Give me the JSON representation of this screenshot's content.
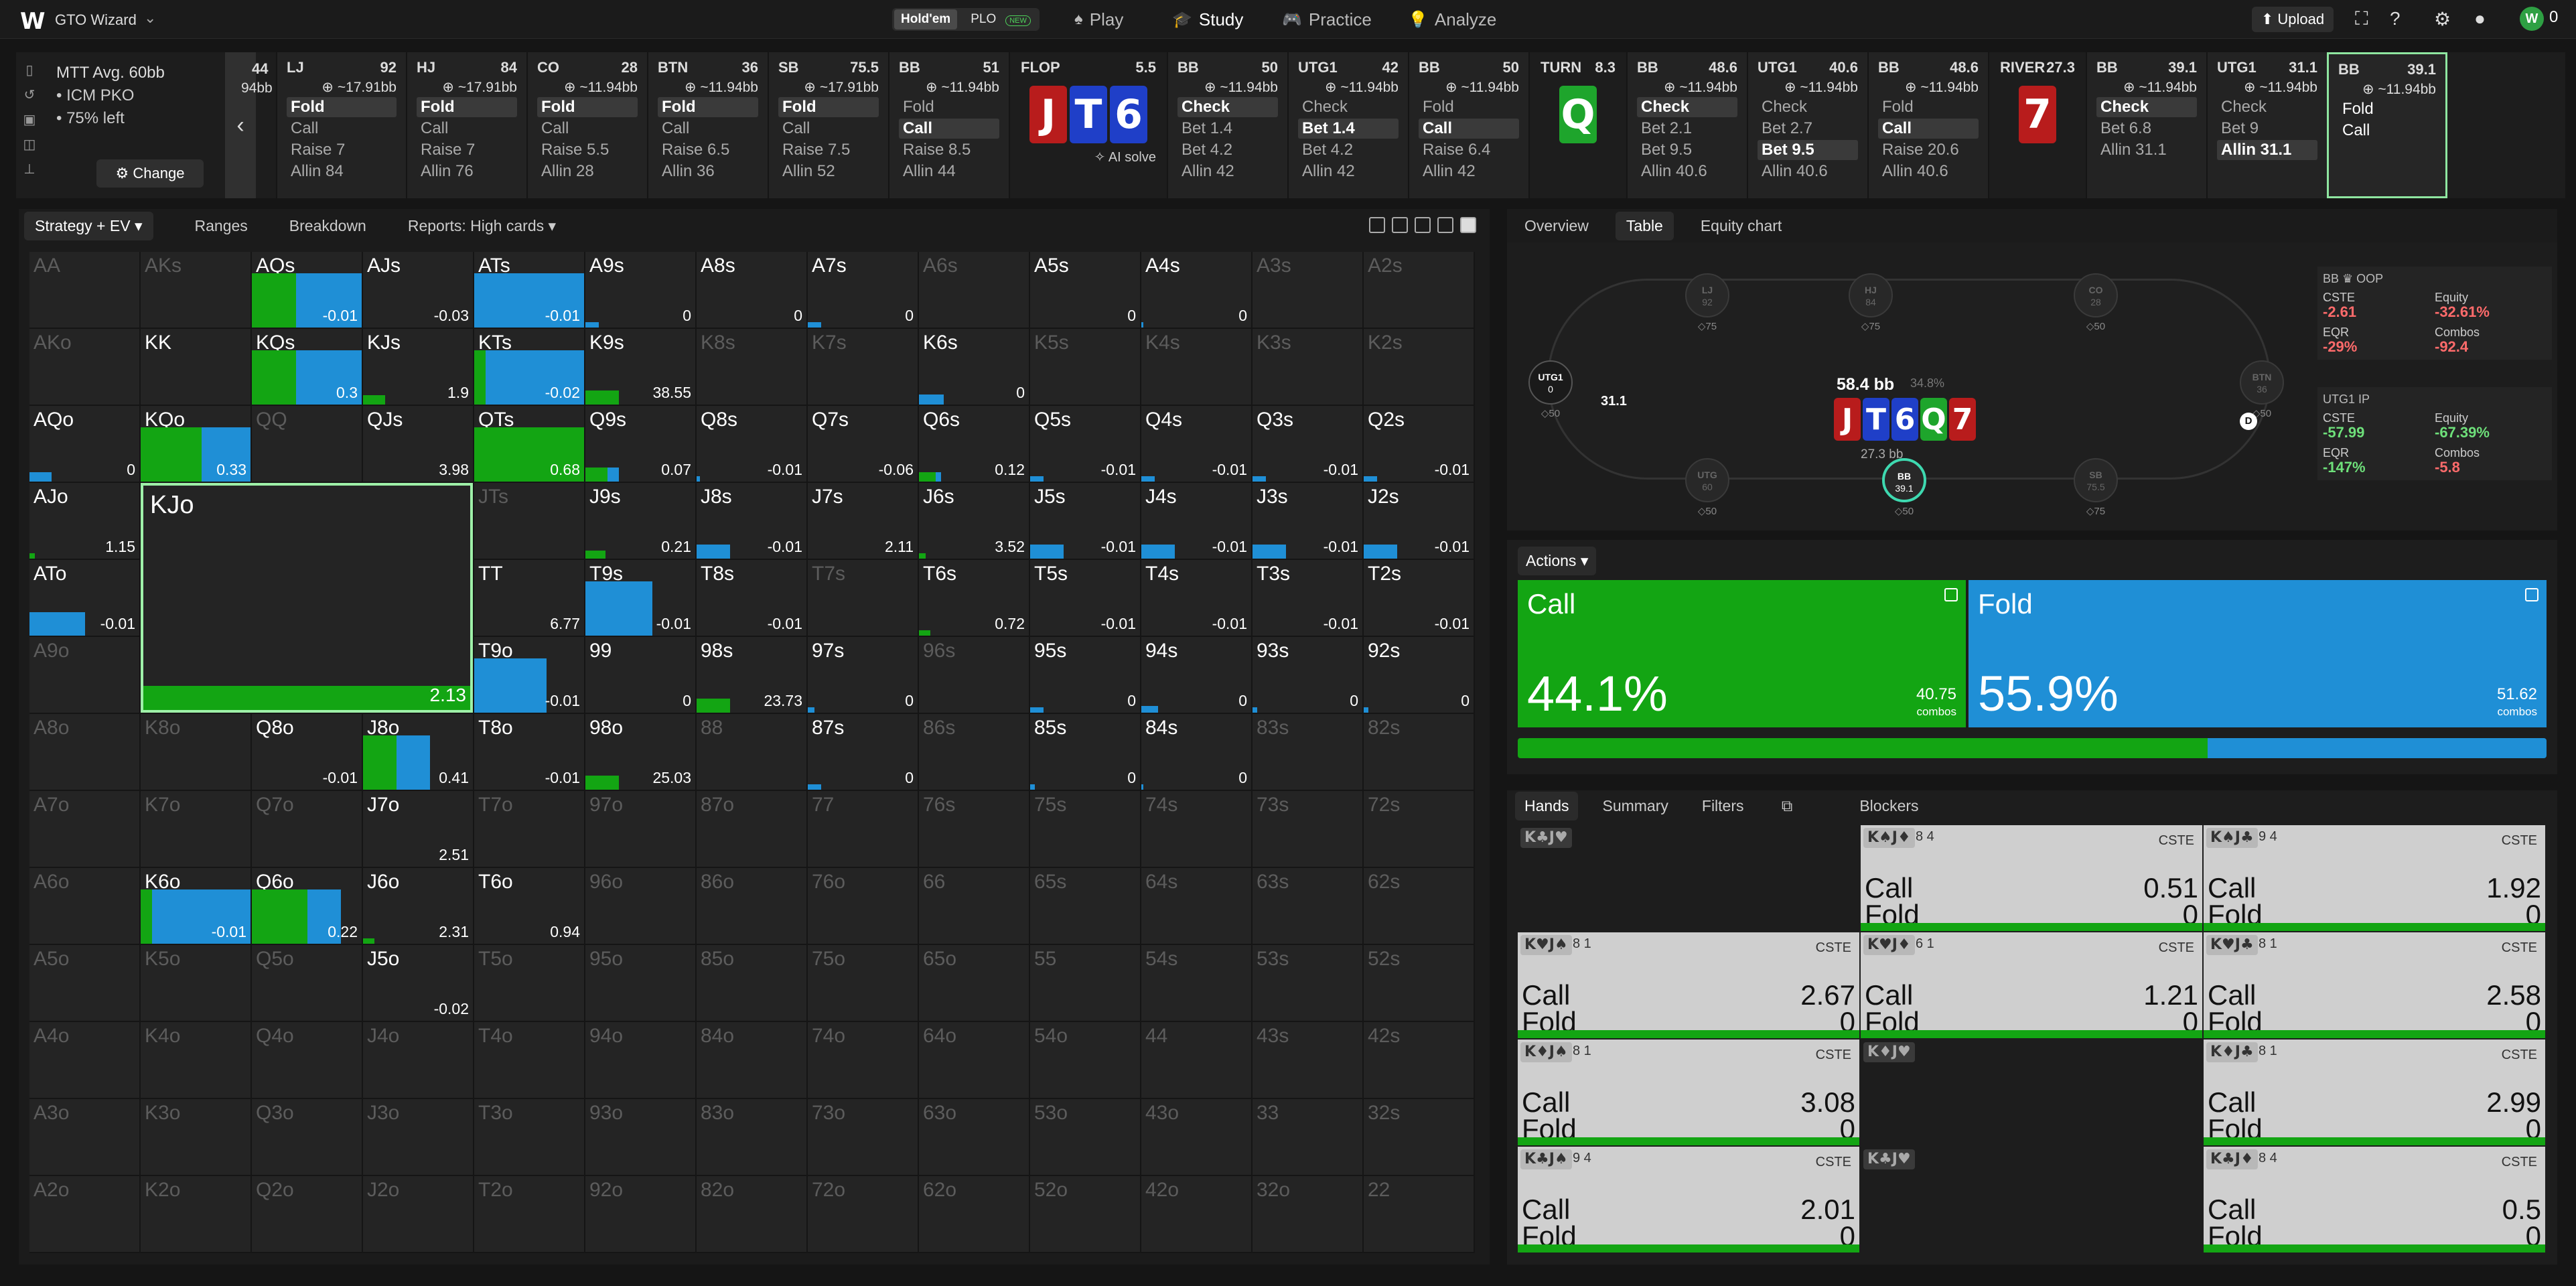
{
  "nav": {
    "logo": "W",
    "brand": "GTO Wizard",
    "game_toggle": [
      "Hold'em",
      "PLO"
    ],
    "new_badge": "NEW",
    "items": [
      {
        "label": "Play",
        "icon": "play-icon"
      },
      {
        "label": "Study",
        "icon": "study-icon"
      },
      {
        "label": "Practice",
        "icon": "practice-icon"
      },
      {
        "label": "Analyze",
        "icon": "analyze-icon"
      }
    ],
    "upload": "Upload",
    "coins": "0"
  },
  "tournament": {
    "line1": "MTT  Avg. 60bb",
    "line2": "•  ICM PKO",
    "line3": "•  75% left",
    "change": "Change"
  },
  "prev_card": {
    "top": "44",
    "sub": "94bb"
  },
  "cards": [
    {
      "pos": "LJ",
      "num": "92",
      "stack": "~17.91bb",
      "opts": [
        "Fold",
        "Call",
        "Raise 7",
        "Allin 84"
      ],
      "sel": 0
    },
    {
      "pos": "HJ",
      "num": "84",
      "stack": "~17.91bb",
      "opts": [
        "Fold",
        "Call",
        "Raise 7",
        "Allin 76"
      ],
      "sel": 0
    },
    {
      "pos": "CO",
      "num": "28",
      "stack": "~11.94bb",
      "opts": [
        "Fold",
        "Call",
        "Raise 5.5",
        "Allin 28"
      ],
      "sel": 0
    },
    {
      "pos": "BTN",
      "num": "36",
      "stack": "~11.94bb",
      "opts": [
        "Fold",
        "Call",
        "Raise 6.5",
        "Allin 36"
      ],
      "sel": 0
    },
    {
      "pos": "SB",
      "num": "75.5",
      "stack": "~17.91bb",
      "opts": [
        "Fold",
        "Call",
        "Raise 7.5",
        "Allin 52"
      ],
      "sel": 0
    },
    {
      "pos": "BB",
      "num": "51",
      "stack": "~11.94bb",
      "opts": [
        "Fold",
        "Call",
        "Raise 8.5",
        "Allin 44"
      ],
      "sel": 1
    },
    {
      "street": "FLOP",
      "num": "5.5",
      "board": [
        [
          "J",
          "#b81c1c"
        ],
        [
          "T",
          "#1f3fc8"
        ],
        [
          "6",
          "#1f3fc8"
        ]
      ],
      "ai": "AI solve"
    },
    {
      "pos": "BB",
      "num": "50",
      "stack": "~11.94bb",
      "opts": [
        "Check",
        "Bet 1.4",
        "Bet 4.2",
        "Allin 42"
      ],
      "sel": 0
    },
    {
      "pos": "UTG1",
      "num": "42",
      "stack": "~11.94bb",
      "opts": [
        "Check",
        "Bet 1.4",
        "Bet 4.2",
        "Allin 42"
      ],
      "sel": 1
    },
    {
      "pos": "BB",
      "num": "50",
      "stack": "~11.94bb",
      "opts": [
        "Fold",
        "Call",
        "Raise 6.4",
        "Allin 42"
      ],
      "sel": 1
    },
    {
      "street": "TURN",
      "num": "8.3",
      "board": [
        [
          "Q",
          "#1ea52c"
        ]
      ]
    },
    {
      "pos": "BB",
      "num": "48.6",
      "stack": "~11.94bb",
      "opts": [
        "Check",
        "Bet 2.1",
        "Bet 9.5",
        "Allin 40.6"
      ],
      "sel": 0
    },
    {
      "pos": "UTG1",
      "num": "40.6",
      "stack": "~11.94bb",
      "opts": [
        "Check",
        "Bet 2.7",
        "Bet 9.5",
        "Allin 40.6"
      ],
      "sel": 2
    },
    {
      "pos": "BB",
      "num": "48.6",
      "stack": "~11.94bb",
      "opts": [
        "Fold",
        "Call",
        "Raise 20.6",
        "Allin 40.6"
      ],
      "sel": 1
    },
    {
      "street": "RIVER",
      "num": "27.3",
      "board": [
        [
          "7",
          "#b81c1c"
        ]
      ]
    },
    {
      "pos": "BB",
      "num": "39.1",
      "stack": "~11.94bb",
      "opts": [
        "Check",
        "Bet 6.8",
        "Allin 31.1"
      ],
      "sel": 0
    },
    {
      "pos": "UTG1",
      "num": "31.1",
      "stack": "~11.94bb",
      "opts": [
        "Check",
        "Bet 9",
        "Allin 31.1"
      ],
      "sel": 2
    },
    {
      "pos": "BB",
      "num": "39.1",
      "stack": "~11.94bb",
      "opts": [
        "Fold",
        "Call"
      ],
      "sel": -1,
      "active": true
    }
  ],
  "matrix_tabs": [
    "Strategy + EV",
    "Ranges",
    "Breakdown",
    "Reports: High cards"
  ],
  "matrix": {
    "ranks": [
      "A",
      "K",
      "Q",
      "J",
      "T",
      "9",
      "8",
      "7",
      "6",
      "5",
      "4",
      "3",
      "2"
    ],
    "zoom": {
      "hand": "KJo",
      "ev": "2.13"
    },
    "cells": {
      "AQs": {
        "c": 0.4,
        "f": 0.6,
        "ev": "-0.01"
      },
      "AJs": {
        "c": 0,
        "f": 0,
        "ev": "-0.03"
      },
      "ATs": {
        "c": 0,
        "f": 1,
        "ev": "-0.01"
      },
      "A9s": {
        "c": 0,
        "f": 0.12,
        "ev": "0"
      },
      "A8s": {
        "c": 0,
        "f": 0,
        "ev": "0"
      },
      "A7s": {
        "c": 0,
        "f": 0.12,
        "ev": "0"
      },
      "A5s": {
        "c": 0,
        "f": 0,
        "ev": "0"
      },
      "A4s": {
        "c": 0,
        "f": 0.02,
        "ev": "0"
      },
      "KQs": {
        "c": 0.4,
        "f": 0.6,
        "ev": "0.3"
      },
      "KJs": {
        "c": 0.2,
        "f": 0,
        "ev": "1.9"
      },
      "KTs": {
        "c": 0.1,
        "f": 0.9,
        "ev": "-0.02"
      },
      "K9s": {
        "c": 0.3,
        "f": 0,
        "ev": "38.55"
      },
      "K6s": {
        "c": 0,
        "f": 0.22,
        "ev": "0"
      },
      "AQo": {
        "c": 0,
        "f": 0.2,
        "ev": "0"
      },
      "KQo": {
        "c": 0.55,
        "f": 0.45,
        "ev": "0.33"
      },
      "QJs": {
        "c": 0,
        "f": 0,
        "ev": "3.98"
      },
      "QTs": {
        "c": 1,
        "f": 0,
        "ev": "0.68"
      },
      "Q9s": {
        "c": 0.2,
        "f": 0.1,
        "ev": "0.07"
      },
      "Q8s": {
        "c": 0,
        "f": 0.03,
        "ev": "-0.01"
      },
      "Q7s": {
        "c": 0,
        "f": 0,
        "ev": "-0.06"
      },
      "Q6s": {
        "c": 0.15,
        "f": 0.05,
        "ev": "0.12"
      },
      "Q5s": {
        "c": 0,
        "f": 0.12,
        "ev": "-0.01"
      },
      "Q4s": {
        "c": 0,
        "f": 0.12,
        "ev": "-0.01"
      },
      "Q3s": {
        "c": 0,
        "f": 0.12,
        "ev": "-0.01"
      },
      "Q2s": {
        "c": 0,
        "f": 0.12,
        "ev": "-0.01"
      },
      "AJo": {
        "c": 0.05,
        "f": 0,
        "ev": "1.15"
      },
      "J9s": {
        "c": 0.18,
        "f": 0,
        "ev": "0.21"
      },
      "J8s": {
        "c": 0,
        "f": 0.3,
        "ev": "-0.01"
      },
      "J7s": {
        "c": 0,
        "f": 0,
        "ev": "2.11"
      },
      "J6s": {
        "c": 0.06,
        "f": 0,
        "ev": "3.52"
      },
      "J5s": {
        "c": 0,
        "f": 0.3,
        "ev": "-0.01"
      },
      "J4s": {
        "c": 0,
        "f": 0.3,
        "ev": "-0.01"
      },
      "J3s": {
        "c": 0,
        "f": 0.3,
        "ev": "-0.01"
      },
      "J2s": {
        "c": 0,
        "f": 0.3,
        "ev": "-0.01"
      },
      "ATo": {
        "c": 0,
        "f": 0.5,
        "ev": "-0.01"
      },
      "TT": {
        "c": 0,
        "f": 0,
        "ev": "6.77"
      },
      "T9s": {
        "c": 0,
        "f": 0.6,
        "ev": "-0.01"
      },
      "T8s": {
        "c": 0,
        "f": 0,
        "ev": "-0.01"
      },
      "T6s": {
        "c": 0.1,
        "f": 0,
        "ev": "0.72"
      },
      "T5s": {
        "c": 0,
        "f": 0,
        "ev": "-0.01"
      },
      "T4s": {
        "c": 0,
        "f": 0,
        "ev": "-0.01"
      },
      "T3s": {
        "c": 0,
        "f": 0,
        "ev": "-0.01"
      },
      "T2s": {
        "c": 0,
        "f": 0,
        "ev": "-0.01"
      },
      "T9o": {
        "c": 0,
        "f": 0.65,
        "ev": "-0.01"
      },
      "99": {
        "c": 0,
        "f": 0,
        "ev": "0"
      },
      "98s": {
        "c": 0.3,
        "f": 0,
        "ev": "23.73"
      },
      "97s": {
        "c": 0,
        "f": 0.06,
        "ev": "0"
      },
      "95s": {
        "c": 0,
        "f": 0.12,
        "ev": "0"
      },
      "94s": {
        "c": 0,
        "f": 0.15,
        "ev": "0"
      },
      "93s": {
        "c": 0,
        "f": 0.04,
        "ev": "0"
      },
      "92s": {
        "c": 0,
        "f": 0.04,
        "ev": "0"
      },
      "Q8o": {
        "c": 0,
        "f": 0,
        "ev": "-0.01"
      },
      "J8o": {
        "c": 0.3,
        "f": 0.3,
        "ev": "0.41"
      },
      "T8o": {
        "c": 0,
        "f": 0,
        "ev": "-0.01"
      },
      "98o": {
        "c": 0.3,
        "f": 0,
        "ev": "25.03"
      },
      "87s": {
        "c": 0,
        "f": 0.12,
        "ev": "0"
      },
      "85s": {
        "c": 0,
        "f": 0.04,
        "ev": "0"
      },
      "84s": {
        "c": 0,
        "f": 0.02,
        "ev": "0"
      },
      "J7o": {
        "c": 0,
        "f": 0,
        "ev": "2.51"
      },
      "K6o": {
        "c": 0.1,
        "f": 0.9,
        "ev": "-0.01"
      },
      "Q6o": {
        "c": 0.5,
        "f": 0.3,
        "ev": "0.22"
      },
      "J6o": {
        "c": 0.1,
        "f": 0,
        "ev": "2.31"
      },
      "T6o": {
        "c": 0,
        "f": 0,
        "ev": "0.94"
      },
      "J5o": {
        "c": 0,
        "f": 0,
        "ev": "-0.02"
      }
    },
    "bright": [
      "AQs",
      "AJs",
      "ATs",
      "A9s",
      "A8s",
      "A7s",
      "A5s",
      "A4s",
      "KQs",
      "KJs",
      "KTs",
      "K9s",
      "K6s",
      "AQo",
      "KQo",
      "QJs",
      "QTs",
      "Q9s",
      "Q8s",
      "Q7s",
      "Q6s",
      "Q5s",
      "Q4s",
      "Q3s",
      "Q2s",
      "AJo",
      "J9s",
      "J8s",
      "J7s",
      "J6s",
      "J5s",
      "J4s",
      "J3s",
      "J2s",
      "ATo",
      "TT",
      "T9s",
      "T8s",
      "T6s",
      "T5s",
      "T4s",
      "T3s",
      "T2s",
      "T9o",
      "99",
      "98s",
      "97s",
      "95s",
      "94s",
      "93s",
      "92s",
      "Q8o",
      "J8o",
      "T8o",
      "98o",
      "87s",
      "85s",
      "84s",
      "J7o",
      "K6o",
      "Q6o",
      "J6o",
      "T6o",
      "J5o",
      "KK"
    ]
  },
  "right_tabs": [
    "Overview",
    "Table",
    "Equity chart"
  ],
  "table": {
    "seats": [
      {
        "name": "LJ",
        "val": "92",
        "st": "◇75"
      },
      {
        "name": "HJ",
        "val": "84",
        "st": "◇75"
      },
      {
        "name": "CO",
        "val": "28",
        "st": "◇50"
      },
      {
        "name": "BTN",
        "val": "36",
        "st": "◇50"
      },
      {
        "name": "SB",
        "val": "75.5",
        "st": "◇75"
      },
      {
        "name": "BB",
        "val": "39.1",
        "st": "◇50"
      },
      {
        "name": "UTG",
        "val": "60",
        "st": "◇50"
      },
      {
        "name": "UTG1",
        "val": "0",
        "st": "◇50"
      }
    ],
    "pot": "58.4 bb",
    "pot_pct": "34.8%",
    "board": [
      [
        "J",
        "#b81c1c"
      ],
      [
        "T",
        "#1f3fc8"
      ],
      [
        "6",
        "#1f3fc8"
      ],
      [
        "Q",
        "#1ea52c"
      ],
      [
        "7",
        "#b81c1c"
      ]
    ],
    "pot_base": "27.3 bb",
    "bet": "31.1",
    "dealer": "D"
  },
  "stats": [
    {
      "title": "BB ♛ OOP",
      "cste": "-2.61",
      "equity": "-32.61%",
      "eqr": "-29%",
      "combos": "-92.4"
    },
    {
      "title": "UTG1  IP",
      "cste": "-57.99",
      "equity": "-67.39%",
      "eqr": "-147%",
      "combos": "-5.8"
    }
  ],
  "stat_labels": {
    "cste": "CSTE",
    "equity": "Equity",
    "eqr": "EQR",
    "combos": "Combos"
  },
  "actions": {
    "button": "Actions",
    "call": {
      "name": "Call",
      "pct": "44.1%",
      "combos": "40.75",
      "combos_label": "combos",
      "freq": 0.441
    },
    "fold": {
      "name": "Fold",
      "pct": "55.9%",
      "combos": "51.62",
      "combos_label": "combos",
      "freq": 0.559
    }
  },
  "hand_tabs": [
    "Hands",
    "Summary",
    "Filters",
    "Blockers"
  ],
  "hands": [
    {
      "combo": "K♣J♥",
      "empty": true
    },
    {
      "combo": "K♠J♦",
      "blk": "8 4",
      "cste": "CSTE",
      "call": "0.51",
      "fold": "0"
    },
    {
      "combo": "K♠J♣",
      "blk": "9 4",
      "cste": "CSTE",
      "call": "1.92",
      "fold": "0"
    },
    {
      "combo": "K♥J♠",
      "blk": "8 1",
      "cste": "CSTE",
      "call": "2.67",
      "fold": "0"
    },
    {
      "combo": "K♥J♦",
      "blk": "6 1",
      "cste": "CSTE",
      "call": "1.21",
      "fold": "0"
    },
    {
      "combo": "K♥J♣",
      "blk": "8 1",
      "cste": "CSTE",
      "call": "2.58",
      "fold": "0"
    },
    {
      "combo": "K♦J♠",
      "blk": "8 1",
      "cste": "CSTE",
      "call": "3.08",
      "fold": "0"
    },
    {
      "combo": "K♦J♥",
      "empty": true
    },
    {
      "combo": "K♦J♣",
      "blk": "8 1",
      "cste": "CSTE",
      "call": "2.99",
      "fold": "0"
    },
    {
      "combo": "K♣J♠",
      "blk": "9 4",
      "cste": "CSTE",
      "call": "2.01",
      "fold": "0"
    },
    {
      "combo": "K♣J♥",
      "empty": true
    },
    {
      "combo": "K♣J♦",
      "blk": "8 4",
      "cste": "CSTE",
      "call": "0.5",
      "fold": "0"
    }
  ],
  "hand_labels": {
    "call": "Call",
    "fold": "Fold"
  },
  "colors": {
    "call": "#13a513",
    "fold": "#1f8fd6",
    "accent": "#6ee07a"
  }
}
